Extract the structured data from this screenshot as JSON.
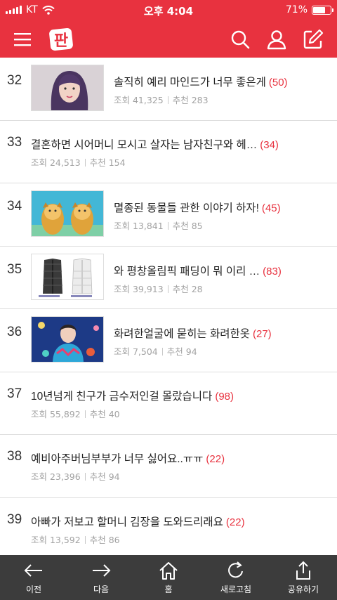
{
  "status": {
    "carrier": "KT",
    "time": "오후 4:04",
    "battery": "71%",
    "battery_level": 0.71
  },
  "colors": {
    "brand": "#e8323f",
    "count": "#e8323f",
    "bottom_bar": "#3c3c3c"
  },
  "header": {
    "logo_text": "판"
  },
  "items": [
    {
      "rank": "32",
      "title": "솔직히 예리 마인드가 너무 좋은게",
      "count": "(50)",
      "views": "조회 41,325",
      "recommend": "추천 283",
      "thumb": "portrait"
    },
    {
      "rank": "33",
      "title": "결혼하면 시어머니 모시고 살자는 남자친구와 헤…",
      "count": "(34)",
      "views": "조회 24,513",
      "recommend": "추천 154",
      "thumb": ""
    },
    {
      "rank": "34",
      "title": "멸종된 동물들 관한 이야기 하자!",
      "count": "(45)",
      "views": "조회 13,841",
      "recommend": "추천 85",
      "thumb": "lions"
    },
    {
      "rank": "35",
      "title": "와 평창올림픽 패딩이 뭐 이리 …",
      "count": "(83)",
      "views": "조회 39,913",
      "recommend": "추천 28",
      "thumb": "coats"
    },
    {
      "rank": "36",
      "title": "화려한얼굴에 묻히는 화려한옷",
      "count": "(27)",
      "views": "조회 7,504",
      "recommend": "추천 94",
      "thumb": "stage"
    },
    {
      "rank": "37",
      "title": "10년넘게 친구가 금수저인걸 몰랐습니다",
      "count": "(98)",
      "views": "조회 55,892",
      "recommend": "추천 40",
      "thumb": ""
    },
    {
      "rank": "38",
      "title": "예비아주버님부부가 너무 싫어요..ㅠㅠ",
      "count": "(22)",
      "views": "조회 23,396",
      "recommend": "추천 94",
      "thumb": ""
    },
    {
      "rank": "39",
      "title": "아빠가 저보고 할머니 김장을 도와드리래요",
      "count": "(22)",
      "views": "조회 13,592",
      "recommend": "추천 86",
      "thumb": ""
    }
  ],
  "bottom_nav": [
    {
      "label": "이전",
      "icon": "arrow-left-icon"
    },
    {
      "label": "다음",
      "icon": "arrow-right-icon"
    },
    {
      "label": "홈",
      "icon": "home-icon"
    },
    {
      "label": "새로고침",
      "icon": "refresh-icon"
    },
    {
      "label": "공유하기",
      "icon": "share-icon"
    }
  ]
}
